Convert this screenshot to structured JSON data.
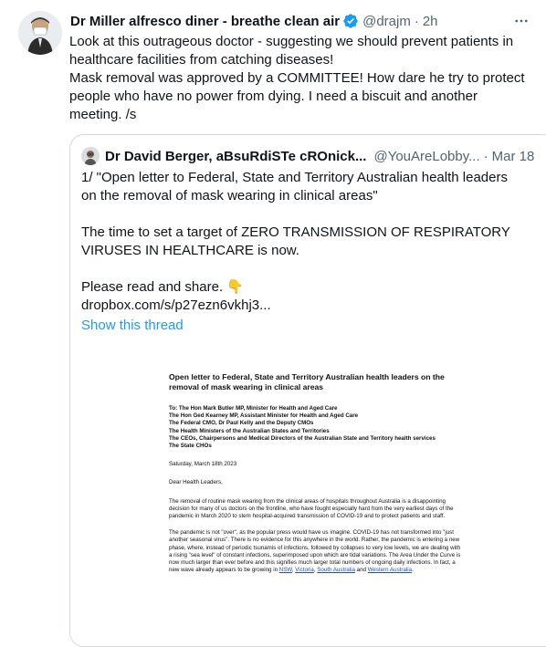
{
  "tweet": {
    "display_name": "Dr Miller alfresco diner - breathe clean air",
    "handle": "@drajm",
    "separator": "·",
    "time": "2h",
    "text_lines": [
      "Look at this outrageous doctor - suggesting we should prevent patients in",
      "healthcare facilities from catching diseases!",
      "Mask removal was approved by a COMMITTEE! How dare he try to protect",
      "people who have no power from dying. I need a biscuit and another",
      "meeting. /s"
    ]
  },
  "quote": {
    "display_name": "Dr David Berger, aBsuRdiSTe cROnick...",
    "handle": "@YouAreLobby...",
    "separator": "·",
    "time": "Mar 18",
    "para1": "1/ \"Open letter to Federal, State and Territory Australian health leaders on the removal of mask wearing in clinical areas\"",
    "para2": "The time to set a target of ZERO TRANSMISSION OF RESPIRATORY VIRUSES IN HEALTHCARE is now.",
    "para3": "Please read and share. 👇",
    "link": "dropbox.com/s/p27ezn6vkhj3...",
    "show_thread": "Show this thread"
  },
  "document": {
    "title": "Open letter to Federal, State and Territory Australian health leaders on the removal of mask wearing in clinical areas",
    "to_lines": [
      "To: The Hon Mark Butler MP, Minister for Health and Aged Care",
      "The Hon Ged Kearney MP, Assistant Minister for Health and Aged Care",
      "The Federal CMO, Dr Paul Kelly and the Deputy CMOs",
      "The Health Ministers of the Australian States and Territories",
      "The CEOs, Chairpersons and Medical Directors of the Australian State and Territory health services",
      "The State CHOs"
    ],
    "date": "Saturday, March 18th 2023",
    "greeting": "Dear Health Leaders,",
    "paragraph1": "The removal of routine mask wearing from the clinical areas of hospitals throughout Australia is a disappointing decision for many of us doctors on the frontline, who have fought especially hard from the very earliest days of the pandemic in March 2020 to stem hospital-acquired transmission of COVID-19 and to protect patients and staff.",
    "paragraph2": "The pandemic is not \"over\", as the popular press would have us imagine. COVID-19 has not transformed into \"just another seasonal virus\". There is no evidence for this anywhere in the world. Rather, the pandemic is entering a new phase, where, instead of periodic tsunamis of infections, followed by collapses to very low levels, we are dealing with a rising \"sea level\" of constant infections, superimposed upon which are tidal variations. The Area Under the Curve is now much larger than ever before and this signifies much larger total numbers of ongoing daily infections. In fact, a new wave already appears to be growing in",
    "link1": "NSW",
    "link2": "Victoria",
    "link3": "South Australia",
    "and_word": "and",
    "link4": "Western Australia",
    "end": "."
  },
  "colors": {
    "text": "#0f1419",
    "secondary": "#536471",
    "accent": "#1d9bf0",
    "border": "#cfd9de",
    "verified": "#1d9bf0"
  },
  "icons": {
    "verified": "verified-badge-icon",
    "more": "more-horizontal-icon",
    "point_down": "point-down-emoji"
  }
}
